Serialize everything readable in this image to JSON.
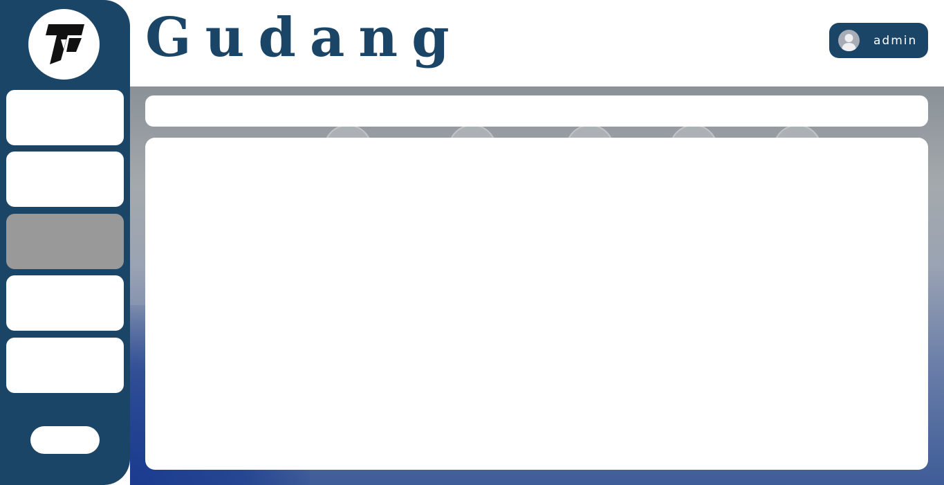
{
  "header": {
    "title": "Gudang"
  },
  "user": {
    "name": "admin",
    "avatar_icon": "user-avatar-icon"
  },
  "brand": {
    "logo_icon": "tp-logo-icon",
    "primary_color": "#1b4566",
    "active_nav_color": "#999999"
  },
  "sidebar": {
    "items": [
      {
        "label": "",
        "active": false
      },
      {
        "label": "",
        "active": false
      },
      {
        "label": "",
        "active": true
      },
      {
        "label": "",
        "active": false
      },
      {
        "label": "",
        "active": false
      }
    ],
    "logout_label": ""
  }
}
